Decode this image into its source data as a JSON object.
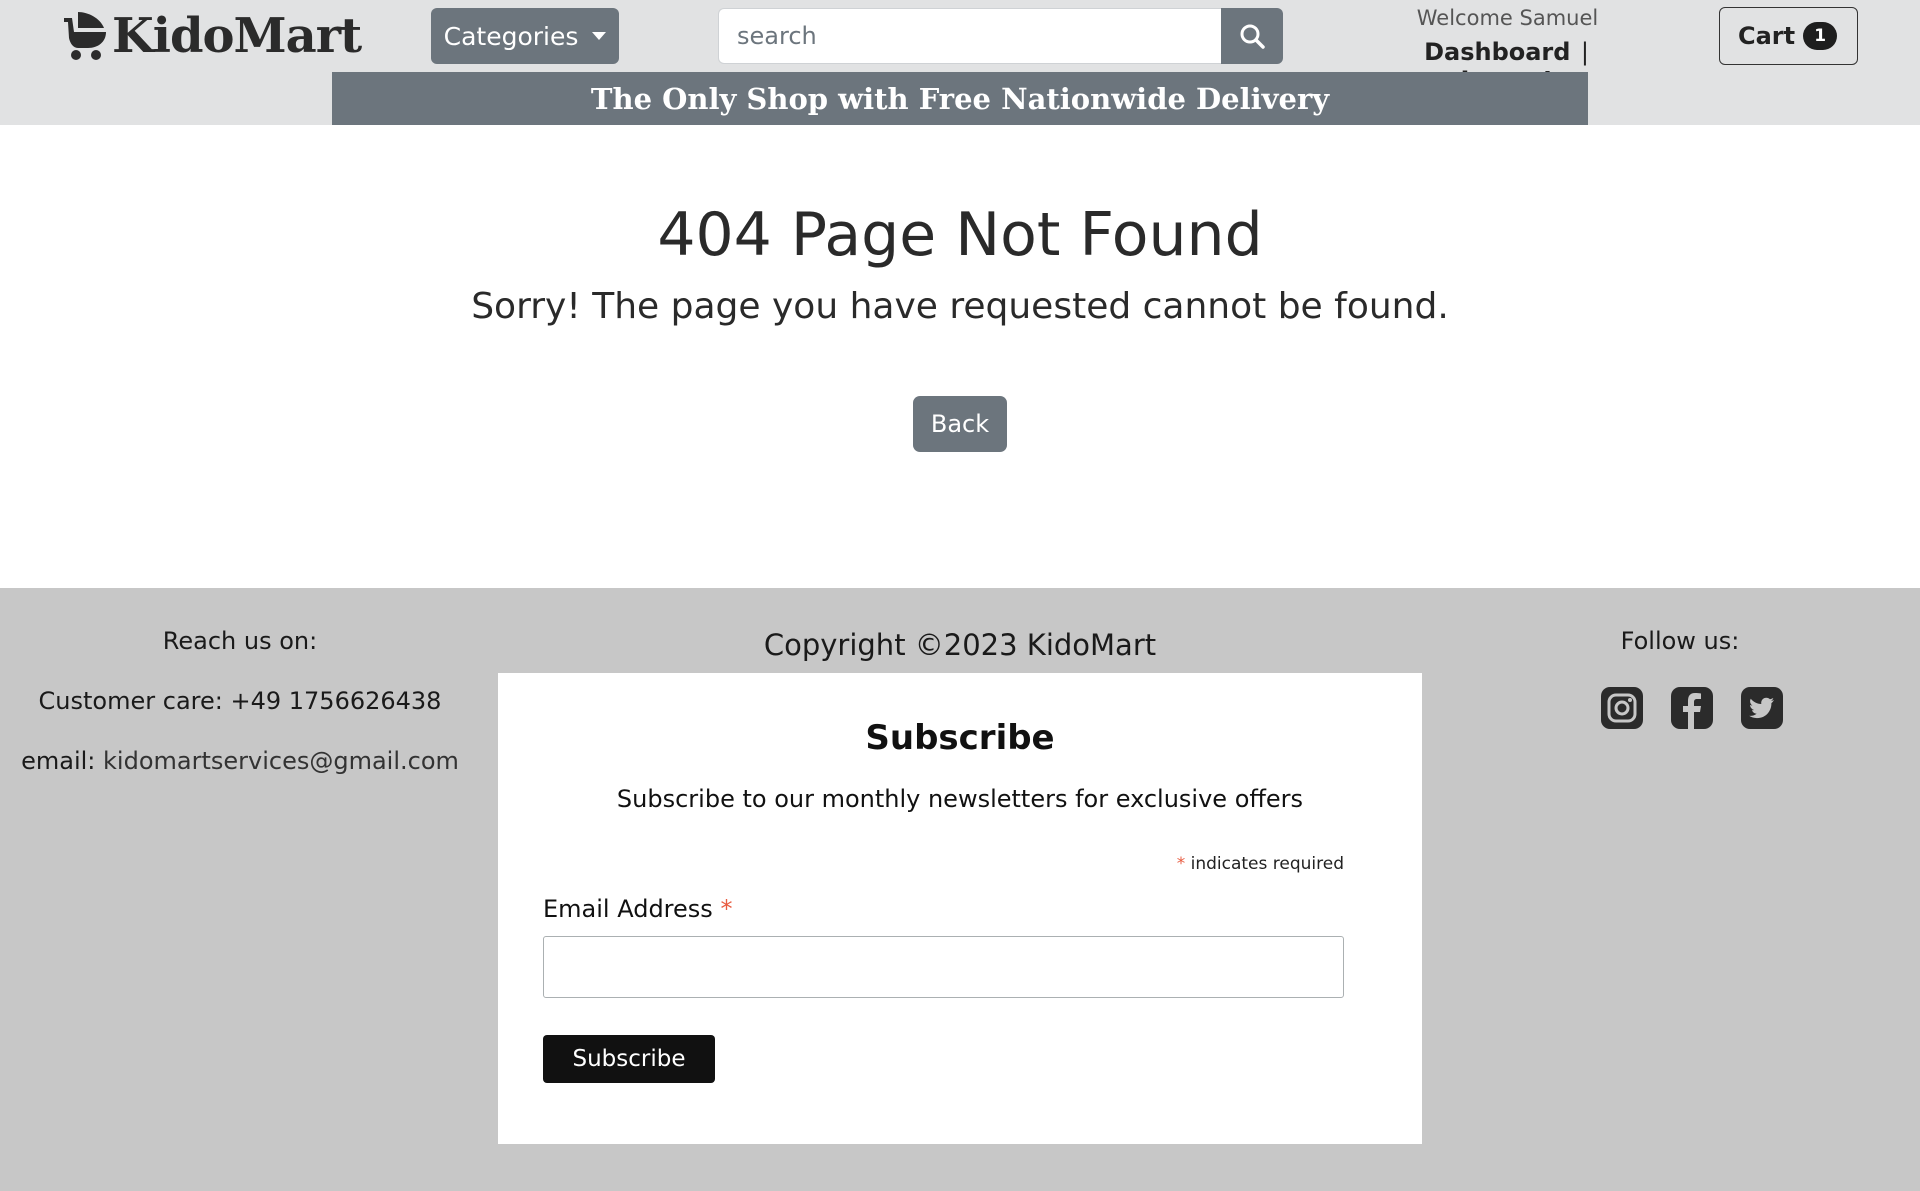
{
  "header": {
    "logo_text": "KidoMart",
    "categories_label": "Categories",
    "search_placeholder": "search",
    "welcome_text": "Welcome Samuel",
    "dashboard_label": "Dashboard",
    "separator": "|",
    "logout_label": "Logout",
    "cart_label": "Cart",
    "cart_count": "1",
    "promo_text": "The Only Shop with Free Nationwide Delivery",
    "icons": {
      "logo": "baby-stroller-icon",
      "search": "search-icon",
      "categories": "caret-down-icon"
    }
  },
  "main": {
    "title": "404 Page Not Found",
    "subtitle": "Sorry! The page you have requested cannot be found.",
    "back_label": "Back"
  },
  "footer": {
    "reach_heading": "Reach us on:",
    "customer_care": "Customer care: +49 1756626438",
    "email_prefix": "email: ",
    "email_address": "kidomartservices@gmail.com",
    "copyright": "Copyright ©2023 KidoMart",
    "follow_heading": "Follow us:",
    "social_icons": [
      "instagram-icon",
      "facebook-icon",
      "twitter-icon"
    ],
    "subscribe": {
      "title": "Subscribe",
      "description": "Subscribe to our monthly newsletters for exclusive offers",
      "required_marker": "*",
      "required_note": " indicates required",
      "email_label": "Email Address",
      "email_value": "",
      "button_label": "Subscribe"
    }
  },
  "colors": {
    "header_bg": "#e1e2e3",
    "accent_gray": "#6c757d",
    "footer_bg": "#c7c7c7",
    "required_red": "#e85c41",
    "subscribe_button": "#111111"
  }
}
